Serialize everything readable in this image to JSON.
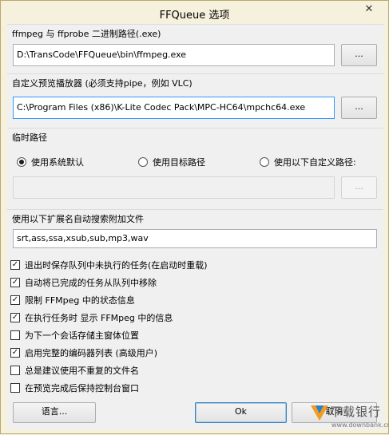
{
  "window": {
    "title": "FFQueue 选项",
    "close_glyph": "✕"
  },
  "ffmpeg_group": {
    "label": "ffmpeg 与 ffprobe 二进制路径(.exe)",
    "path_value": "D:\\TransCode\\FFQueue\\bin\\ffmpeg.exe",
    "browse_label": "..."
  },
  "player_group": {
    "label": "自定义预览播放器 (必须支持pipe，例如 VLC)",
    "path_value": "C:\\Program Files (x86)\\K-Lite Codec Pack\\MPC-HC64\\mpchc64.exe",
    "browse_label": "..."
  },
  "temp_group": {
    "label": "临时路径",
    "options": [
      {
        "label": "使用系统默认",
        "checked": true
      },
      {
        "label": "使用目标路径",
        "checked": false
      },
      {
        "label": "使用以下自定义路径:",
        "checked": false
      }
    ],
    "custom_path_value": "",
    "browse_label": "..."
  },
  "ext_group": {
    "label": "使用以下扩展名自动搜索附加文件",
    "value": "srt,ass,ssa,xsub,sub,mp3,wav"
  },
  "checkboxes": [
    {
      "label": "退出时保存队列中未执行的任务(在启动时重载)",
      "checked": true
    },
    {
      "label": "自动将已完成的任务从队列中移除",
      "checked": true
    },
    {
      "label": "限制 FFMpeg 中的状态信息",
      "checked": true
    },
    {
      "label": "在执行任务时 显示 FFMpeg 中的信息",
      "checked": true
    },
    {
      "label": "为下一个会话存储主窗体位置",
      "checked": false
    },
    {
      "label": "启用完整的编码器列表 (高级用户)",
      "checked": true
    },
    {
      "label": "总是建议使用不重复的文件名",
      "checked": false
    },
    {
      "label": "在预览完成后保持控制台窗口",
      "checked": false
    }
  ],
  "check_mark": "✓",
  "buttons": {
    "language_label": "语言...",
    "ok_label": "Ok",
    "cancel_label": "取消"
  },
  "watermark": {
    "text": "下载银行",
    "url": "www.downbank.cn"
  },
  "colors": {
    "frame": "#f6f1dd",
    "client": "#f0f0f0",
    "focus_border": "#3399ff",
    "watermark_orange": "#f29b1d",
    "watermark_blue": "#2a7fd0"
  }
}
